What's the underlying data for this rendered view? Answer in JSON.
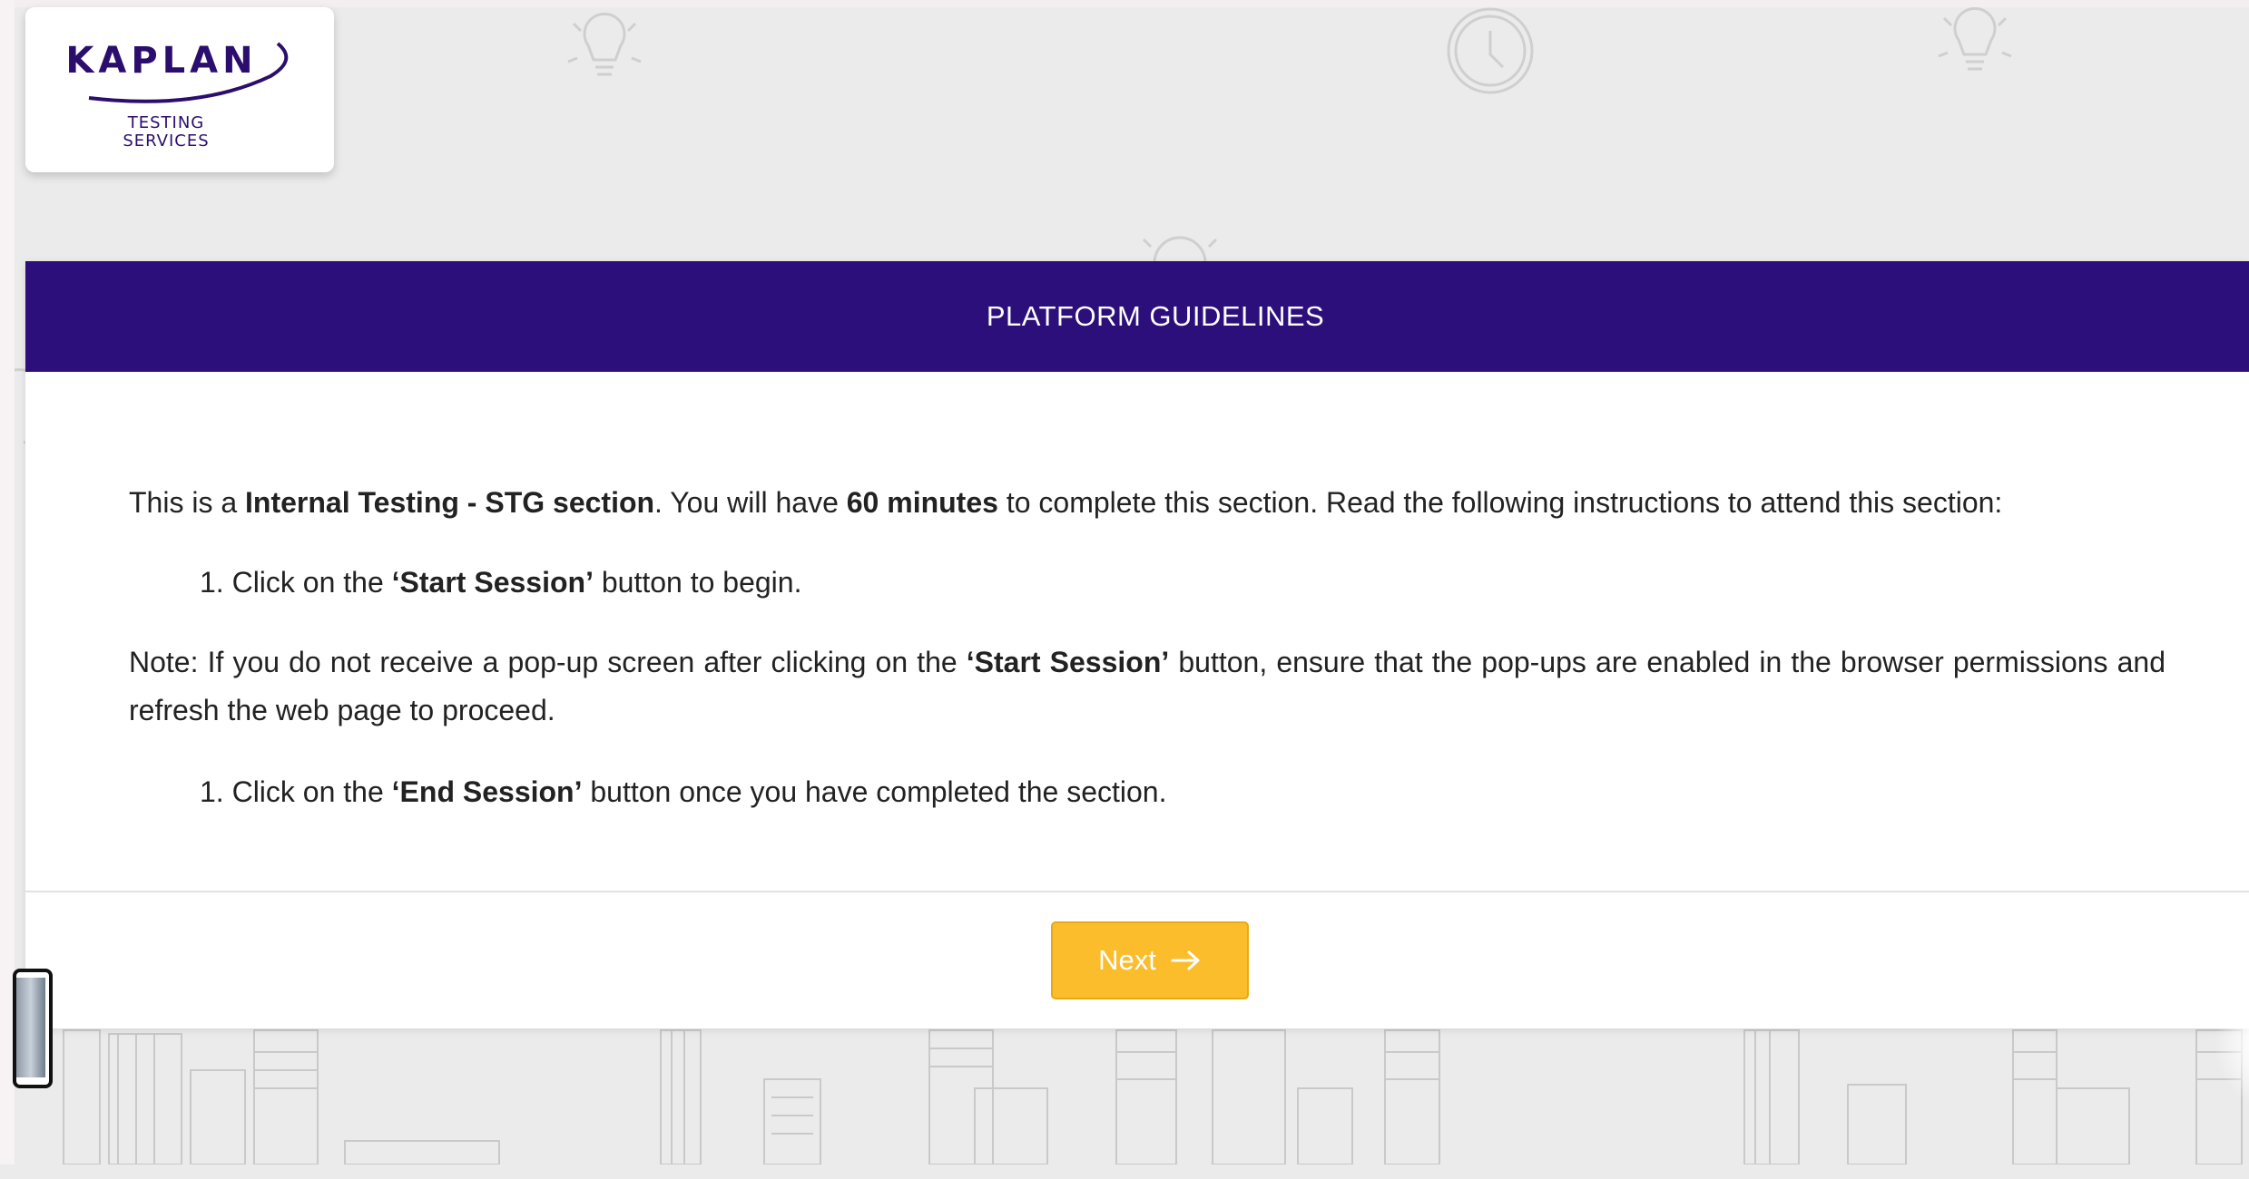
{
  "logo": {
    "name": "KAPLAN",
    "sub_line1": "TESTING",
    "sub_line2": "SERVICES"
  },
  "panel": {
    "title": "PLATFORM GUIDELINES"
  },
  "instructions": {
    "intro_1": "This is a ",
    "section_name": "Internal Testing - STG section",
    "intro_2": ". You will have ",
    "duration": "60 minutes",
    "intro_3": " to complete this section. Read the following instructions to attend this section:",
    "step1_number": "1.",
    "step1_pre": " Click on the ",
    "step1_button": "‘Start Session’",
    "step1_post": " button to begin.",
    "note_pre": "Note: If you do not receive a pop-up screen after clicking on the ",
    "note_button": "‘Start Session’",
    "note_post": " button, ensure that the pop-ups are enabled in the browser permissions and refresh the web page to proceed.",
    "step2_number": "1.",
    "step2_pre": " Click on the ",
    "step2_button": "‘End Session’",
    "step2_post": " button once you have completed the section."
  },
  "footer": {
    "next_label": "Next",
    "next_icon": "arrow-right-icon"
  },
  "colors": {
    "header_bg": "#2c0f7b",
    "brand": "#2b0d6e",
    "next_button": "#fbbd2c",
    "page_bg": "#ebebeb"
  },
  "background_icons": [
    "lightbulb-icon",
    "clock-icon",
    "lightbulb-icon",
    "city-skyline"
  ]
}
